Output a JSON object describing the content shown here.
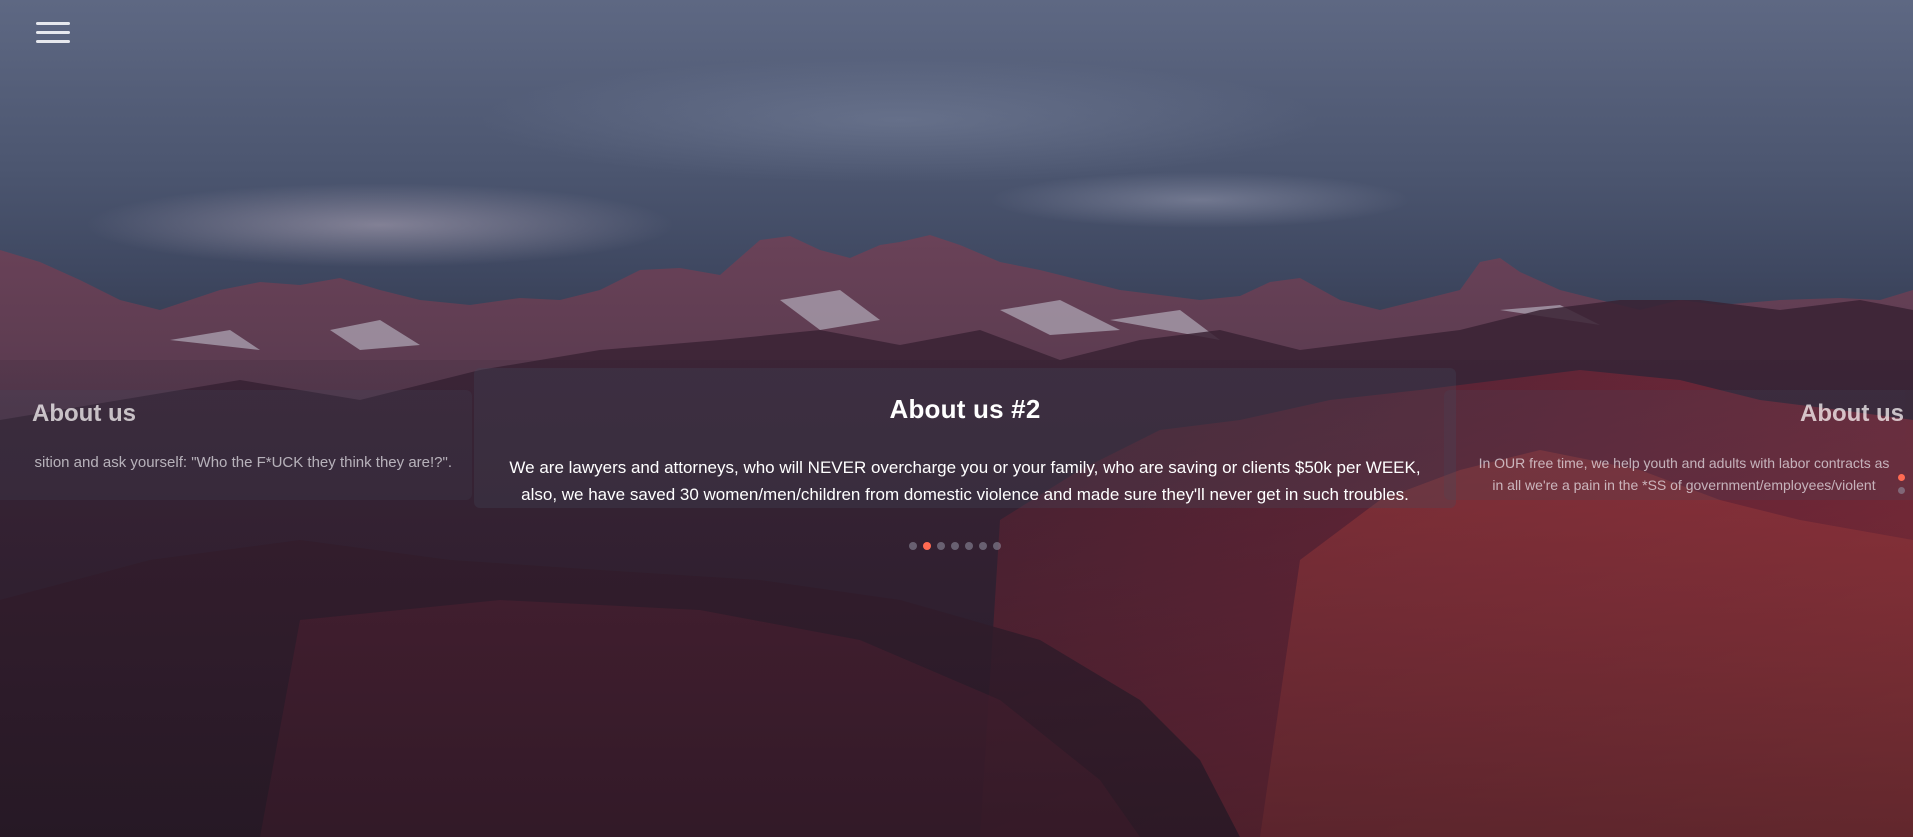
{
  "menu": {
    "icon": "hamburger-menu-icon"
  },
  "carousel": {
    "slides": [
      {
        "title": "About us",
        "text": "sition and ask yourself: \"Who the F*UCK they think they are!?\"."
      },
      {
        "title": "About us #2",
        "text_line1": "We are lawyers and attorneys, who will NEVER overcharge you or your family, who are saving or clients $50k per WEEK,",
        "text_line2": "also, we have saved 30 women/men/children from domestic violence and made sure they'll never get in such troubles."
      },
      {
        "title": "About us",
        "text_line1": "In OUR free time, we help youth and adults with labor contracts as",
        "text_line2": "in all we're a pain in the *SS of government/employees/violent"
      }
    ],
    "dots_count": 7,
    "active_dot": 1,
    "accent_color": "#ff6a52"
  }
}
